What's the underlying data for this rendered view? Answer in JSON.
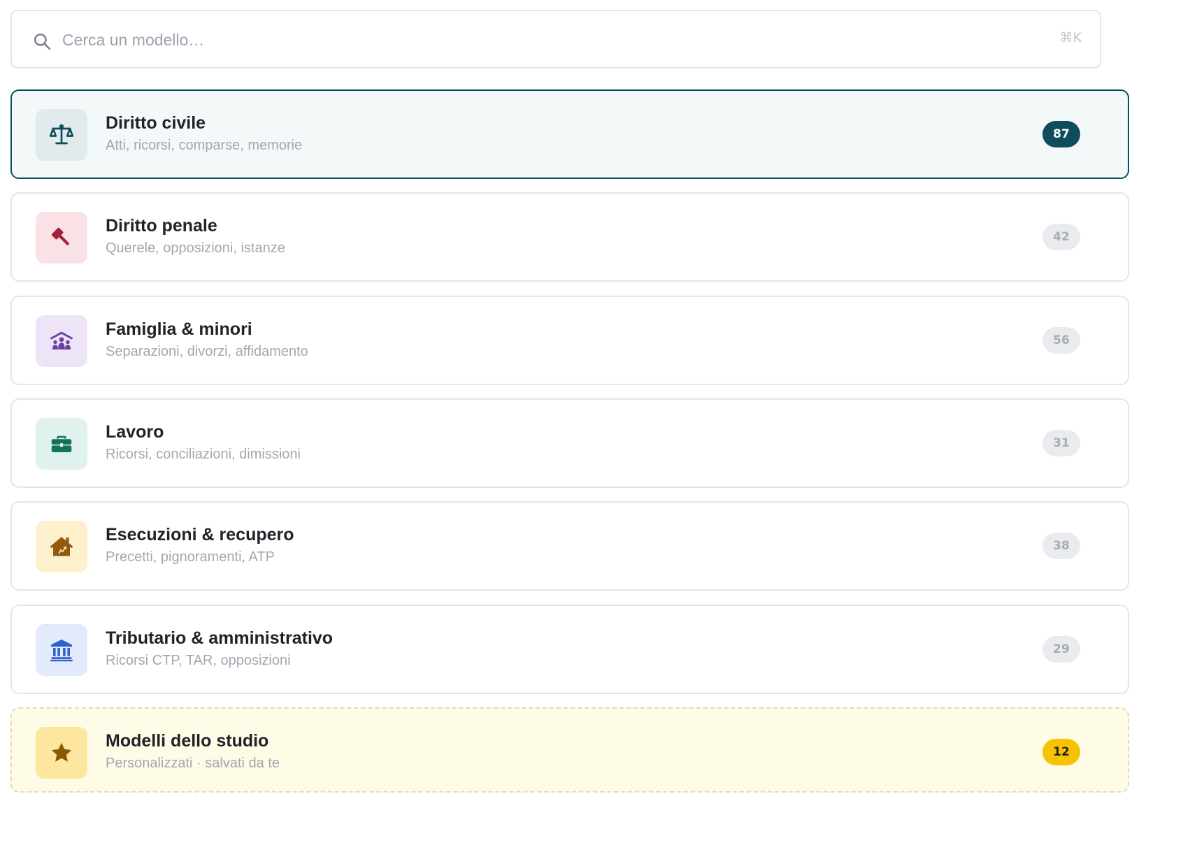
{
  "search": {
    "placeholder": "Cerca un modello…",
    "shortcut": "⌘K",
    "icon": "search-icon"
  },
  "categories": [
    {
      "title": "Diritto civile",
      "subtitle": "Atti, ricorsi, comparse, memorie",
      "count": "87",
      "icon": "scales-icon",
      "icon_color": "#0f4c5c",
      "icon_bg": "#e1ebed",
      "selected": true
    },
    {
      "title": "Diritto penale",
      "subtitle": "Querele, opposizioni, istanze",
      "count": "42",
      "icon": "gavel-icon",
      "icon_color": "#a3213a",
      "icon_bg": "#f9e1e5"
    },
    {
      "title": "Famiglia & minori",
      "subtitle": "Separazioni, divorzi, affidamento",
      "count": "56",
      "icon": "family-icon",
      "icon_color": "#6b3fa0",
      "icon_bg": "#ede4f7"
    },
    {
      "title": "Lavoro",
      "subtitle": "Ricorsi, conciliazioni, dimissioni",
      "count": "31",
      "icon": "briefcase-icon",
      "icon_color": "#14715d",
      "icon_bg": "#dff2ee"
    },
    {
      "title": "Esecuzioni & recupero",
      "subtitle": "Precetti, pignoramenti, ATP",
      "count": "38",
      "icon": "house-icon",
      "icon_color": "#94590c",
      "icon_bg": "#fdf0cc"
    },
    {
      "title": "Tributario & amministrativo",
      "subtitle": "Ricorsi CTP, TAR, opposizioni",
      "count": "29",
      "icon": "bank-icon",
      "icon_color": "#2c5fcf",
      "icon_bg": "#e2eafb"
    },
    {
      "title": "Modelli dello studio",
      "subtitle": "Personalizzati · salvati da te",
      "count": "12",
      "icon": "star-icon",
      "icon_color": "#8a5a00",
      "icon_bg": "#fde79e"
    }
  ]
}
